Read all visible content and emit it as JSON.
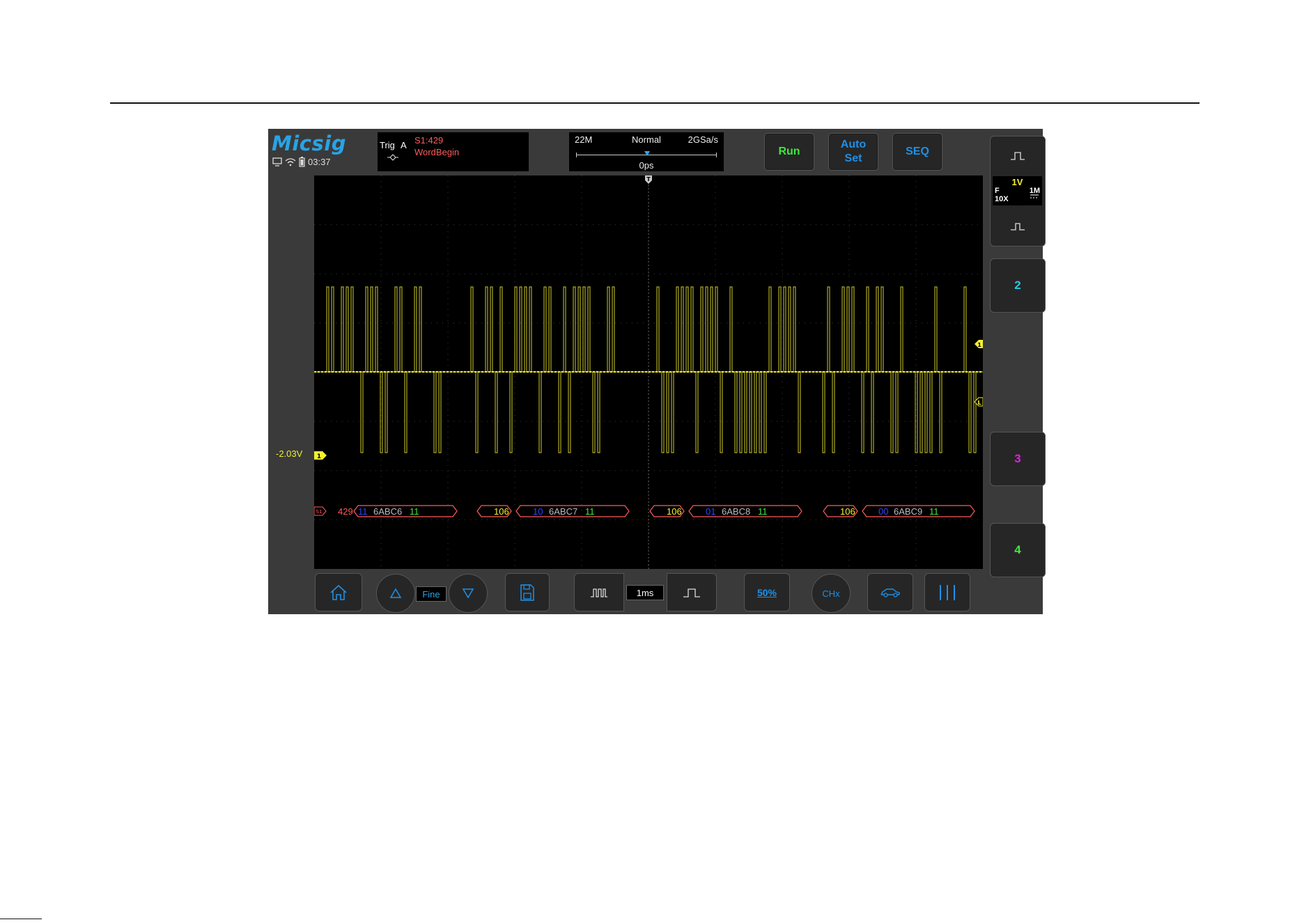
{
  "brand": {
    "logo": "Micsig"
  },
  "status": {
    "time": "03:37",
    "icons": [
      "monitor-icon",
      "wifi-icon",
      "battery-icon"
    ]
  },
  "trigger": {
    "label": "Trig",
    "source": "A",
    "value": "S1:429",
    "mode": "WordBegin"
  },
  "acquisition": {
    "depth": "22M",
    "mode": "Normal",
    "sample_rate": "2GSa/s",
    "offset": "0ps"
  },
  "buttons": {
    "run": "Run",
    "auto_line1": "Auto",
    "auto_line2": "Set",
    "seq": "SEQ"
  },
  "waveform": {
    "channel_marker": "1",
    "offset_voltage": "-2.03V",
    "trigger_marker": "T",
    "level_marker_1": "1",
    "level_marker_l": "L",
    "bus_marker": "S1",
    "trace_color": "#f4f030",
    "bus_color": "#ff5a5a",
    "decode": [
      {
        "kind": "word",
        "label": "429",
        "color": "#ff5a5a"
      },
      {
        "kind": "word",
        "label": "11",
        "color": "#2a48ff"
      },
      {
        "kind": "word",
        "label": "6ABC6",
        "color": "#bbbbbb"
      },
      {
        "kind": "word",
        "label": "11",
        "color": "#3ee83e"
      },
      {
        "kind": "word",
        "label": "106",
        "color": "#f4f030"
      },
      {
        "kind": "word",
        "label": "10",
        "color": "#2a48ff"
      },
      {
        "kind": "word",
        "label": "6ABC7",
        "color": "#bbbbbb"
      },
      {
        "kind": "word",
        "label": "11",
        "color": "#3ee83e"
      },
      {
        "kind": "word",
        "label": "106",
        "color": "#f4f030"
      },
      {
        "kind": "word",
        "label": "01",
        "color": "#2a48ff"
      },
      {
        "kind": "word",
        "label": "6ABC8",
        "color": "#bbbbbb"
      },
      {
        "kind": "word",
        "label": "11",
        "color": "#3ee83e"
      },
      {
        "kind": "word",
        "label": "106",
        "color": "#f4f030"
      },
      {
        "kind": "word",
        "label": "00",
        "color": "#2a48ff"
      },
      {
        "kind": "word",
        "label": "6ABC9",
        "color": "#bbbbbb"
      },
      {
        "kind": "word",
        "label": "11",
        "color": "#3ee83e"
      }
    ]
  },
  "channels": {
    "ch1": {
      "scale": "1V",
      "coupling": "F",
      "impedance": "1M",
      "probe": "10X",
      "color": "#f4f030"
    },
    "ch2": {
      "label": "2",
      "color": "#24c8e8"
    },
    "ch3": {
      "label": "3",
      "color": "#e020e0"
    },
    "ch4": {
      "label": "4",
      "color": "#3ee83e"
    }
  },
  "bottom_bar": {
    "fine": "Fine",
    "timebase": "1ms",
    "fifty_percent": "50%",
    "chx": "CHx"
  },
  "accent": "#1e90e8"
}
